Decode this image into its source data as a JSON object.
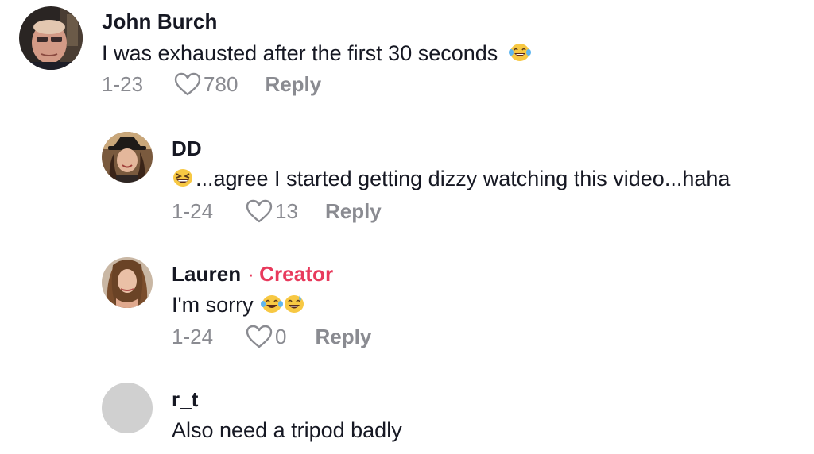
{
  "comments": [
    {
      "username": "John Burch",
      "text": "I was exhausted after the first 30 seconds",
      "emoji_after": [
        "face-with-tears-of-joy"
      ],
      "date": "1-23",
      "likes": "780",
      "reply_label": "Reply"
    },
    {
      "username": "DD",
      "emoji_before": [
        "grinning-squinting-face"
      ],
      "text": "...agree I started getting dizzy watching this video...haha",
      "date": "1-24",
      "likes": "13",
      "reply_label": "Reply"
    },
    {
      "username": "Lauren",
      "separator": "·",
      "badge": "Creator",
      "text": "I'm sorry",
      "emoji_after": [
        "face-with-tears-of-joy",
        "grinning-face-with-sweat"
      ],
      "date": "1-24",
      "likes": "0",
      "reply_label": "Reply"
    },
    {
      "username": "r_t",
      "text": "Also need a tripod badly"
    }
  ],
  "colors": {
    "text": "#161823",
    "muted": "#8a8b91",
    "creator": "#e83a5c",
    "placeholder_avatar": "#d0d0d0"
  }
}
